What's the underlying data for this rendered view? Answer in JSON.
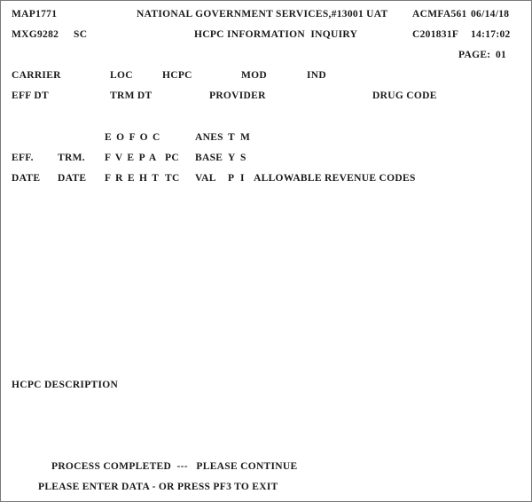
{
  "header": {
    "map_id": "MAP1771",
    "org": "NATIONAL GOVERNMENT SERVICES,#13001 UAT",
    "screen_id": "ACMFA561",
    "date": "06/14/18",
    "user_id": "MXG9282",
    "state": "SC",
    "title": "HCPC INFORMATION  INQUIRY",
    "term_id": "C201831F",
    "time": "14:17:02",
    "page_label": "PAGE:",
    "page_number": "01"
  },
  "fields": {
    "carrier": "CARRIER",
    "loc": "LOC",
    "hcpc": "HCPC",
    "mod": "MOD",
    "ind": "IND",
    "eff_dt": "EFF DT",
    "trm_dt": "TRM DT",
    "provider": "PROVIDER",
    "drug_code": "DRUG CODE"
  },
  "columns": {
    "row1": {
      "flags": "E O F O C",
      "anes": "ANES",
      "t": "T",
      "m": "M"
    },
    "row2": {
      "eff": "EFF.",
      "trm": "TRM.",
      "flags": "F V E P A",
      "pc": "PC",
      "base": "BASE",
      "y": "Y",
      "s": "S"
    },
    "row3": {
      "eff": "DATE",
      "trm": "DATE",
      "flags": "F R E H T",
      "tc": "TC",
      "val": "VAL",
      "p": "P",
      "i": "I",
      "allowable": "ALLOWABLE REVENUE CODES"
    }
  },
  "description_label": "HCPC DESCRIPTION",
  "messages": {
    "status": "PROCESS COMPLETED  ---   PLEASE CONTINUE",
    "prompt": "PLEASE ENTER DATA - OR PRESS PF3 TO EXIT"
  }
}
